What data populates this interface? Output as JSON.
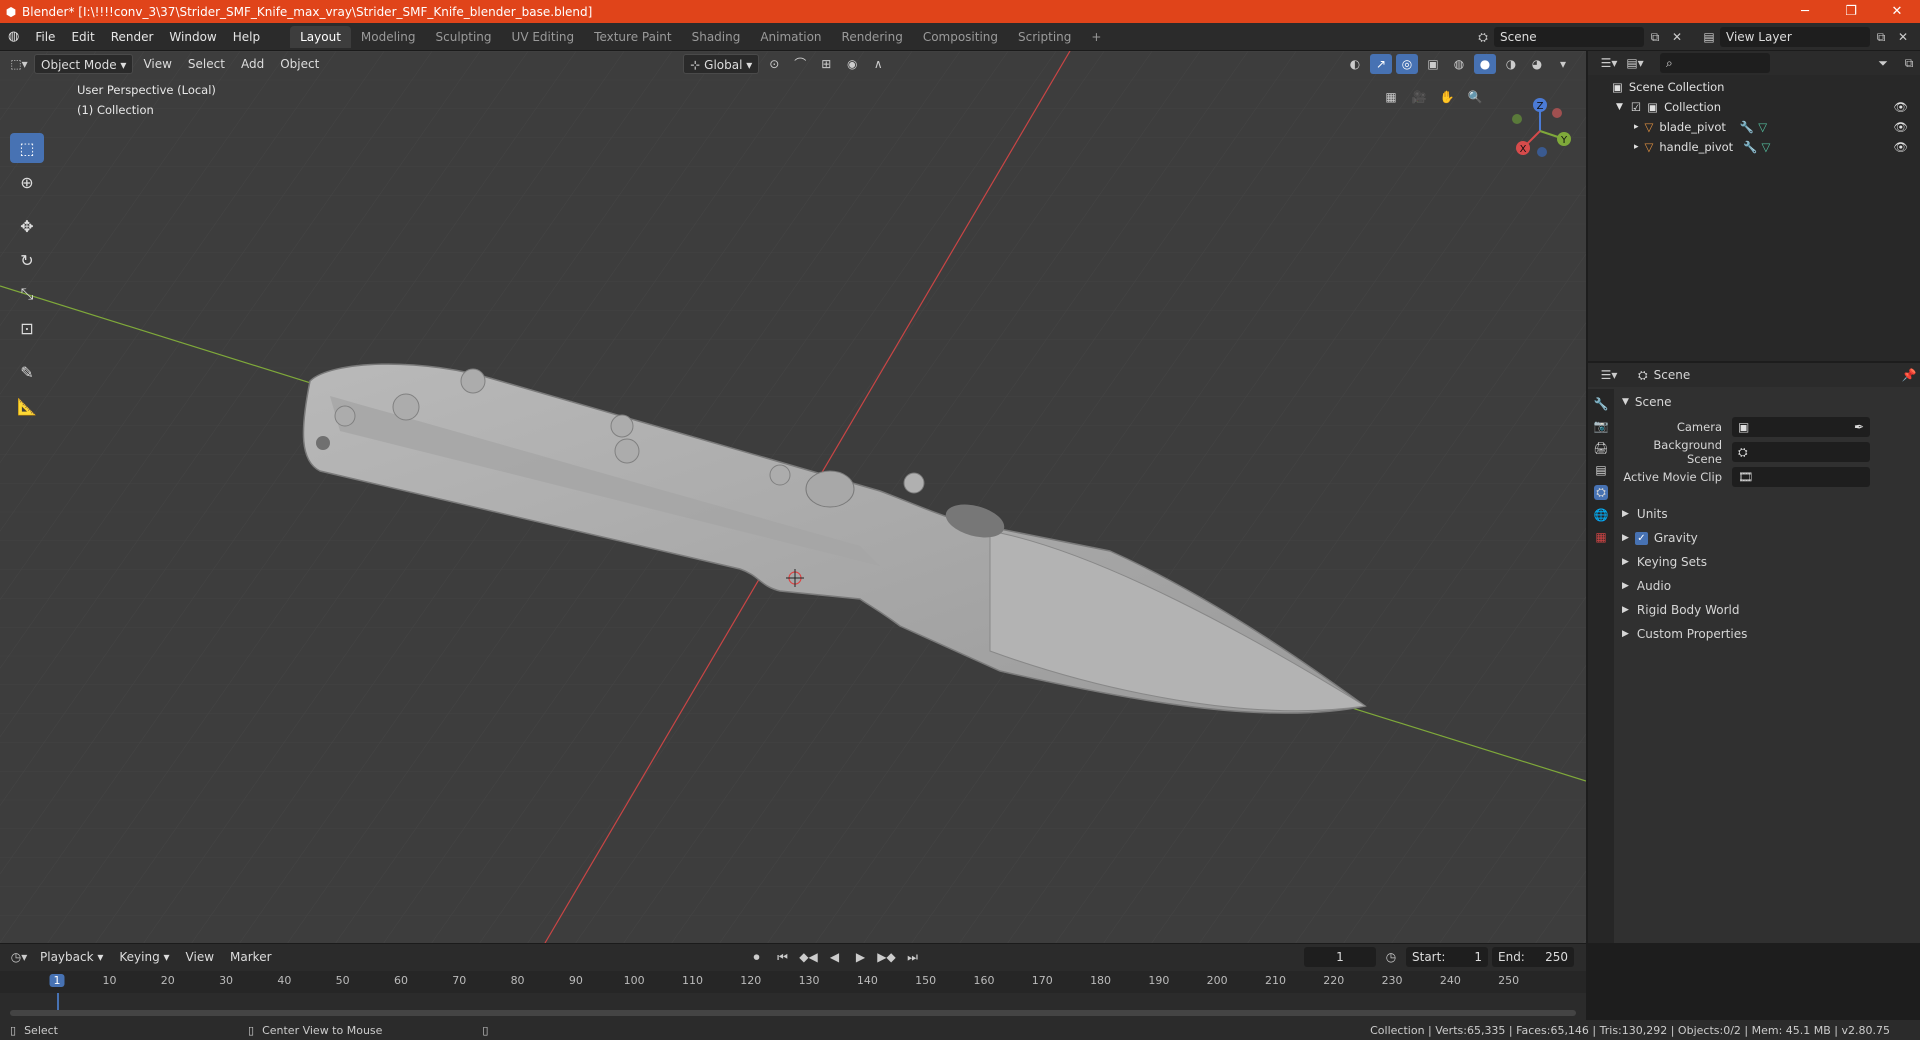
{
  "window": {
    "title": "Blender* [I:\\!!!!conv_3\\37\\Strider_SMF_Knife_max_vray\\Strider_SMF_Knife_blender_base.blend]",
    "minimize": "─",
    "maximize": "❐",
    "close": "✕"
  },
  "menu": [
    "File",
    "Edit",
    "Render",
    "Window",
    "Help"
  ],
  "workspaces": [
    {
      "label": "Layout",
      "active": true
    },
    {
      "label": "Modeling"
    },
    {
      "label": "Sculpting"
    },
    {
      "label": "UV Editing"
    },
    {
      "label": "Texture Paint"
    },
    {
      "label": "Shading"
    },
    {
      "label": "Animation"
    },
    {
      "label": "Rendering"
    },
    {
      "label": "Compositing"
    },
    {
      "label": "Scripting"
    }
  ],
  "add_workspace": "+",
  "scene_field": "Scene",
  "viewlayer_field": "View Layer",
  "viewport": {
    "mode": "Object Mode",
    "menus": [
      "View",
      "Select",
      "Add",
      "Object"
    ],
    "transform": "Global",
    "info_line1": "User Perspective (Local)",
    "info_line2": "(1) Collection"
  },
  "gizmo": {
    "x": "X",
    "y": "Y",
    "z": "Z"
  },
  "outliner": {
    "root": "Scene Collection",
    "collection": "Collection",
    "items": [
      "blade_pivot",
      "handle_pivot"
    ]
  },
  "properties": {
    "header": "Scene",
    "section": "Scene",
    "camera_label": "Camera",
    "bg_scene_label": "Background Scene",
    "movie_clip_label": "Active Movie Clip",
    "panels": [
      "Units",
      "Gravity",
      "Keying Sets",
      "Audio",
      "Rigid Body World",
      "Custom Properties"
    ]
  },
  "timeline": {
    "menus": [
      "Playback",
      "Keying",
      "View",
      "Marker"
    ],
    "current_frame": "1",
    "start_label": "Start:",
    "start": "1",
    "end_label": "End:",
    "end": "250",
    "ticks": [
      "1",
      "10",
      "20",
      "30",
      "40",
      "50",
      "60",
      "70",
      "80",
      "90",
      "100",
      "110",
      "120",
      "130",
      "140",
      "150",
      "160",
      "170",
      "180",
      "190",
      "200",
      "210",
      "220",
      "230",
      "240",
      "250"
    ]
  },
  "status": {
    "left": "Select",
    "middle": "Center View to Mouse",
    "right": "Collection | Verts:65,335 | Faces:65,146 | Tris:130,292 | Objects:0/2 | Mem: 45.1 MB | v2.80.75"
  },
  "colors": {
    "accent": "#4772b3",
    "titlebar": "#e0441a",
    "x_axis": "#d64b4b",
    "y_axis": "#7fa93a",
    "z_axis": "#4b7bd6"
  }
}
